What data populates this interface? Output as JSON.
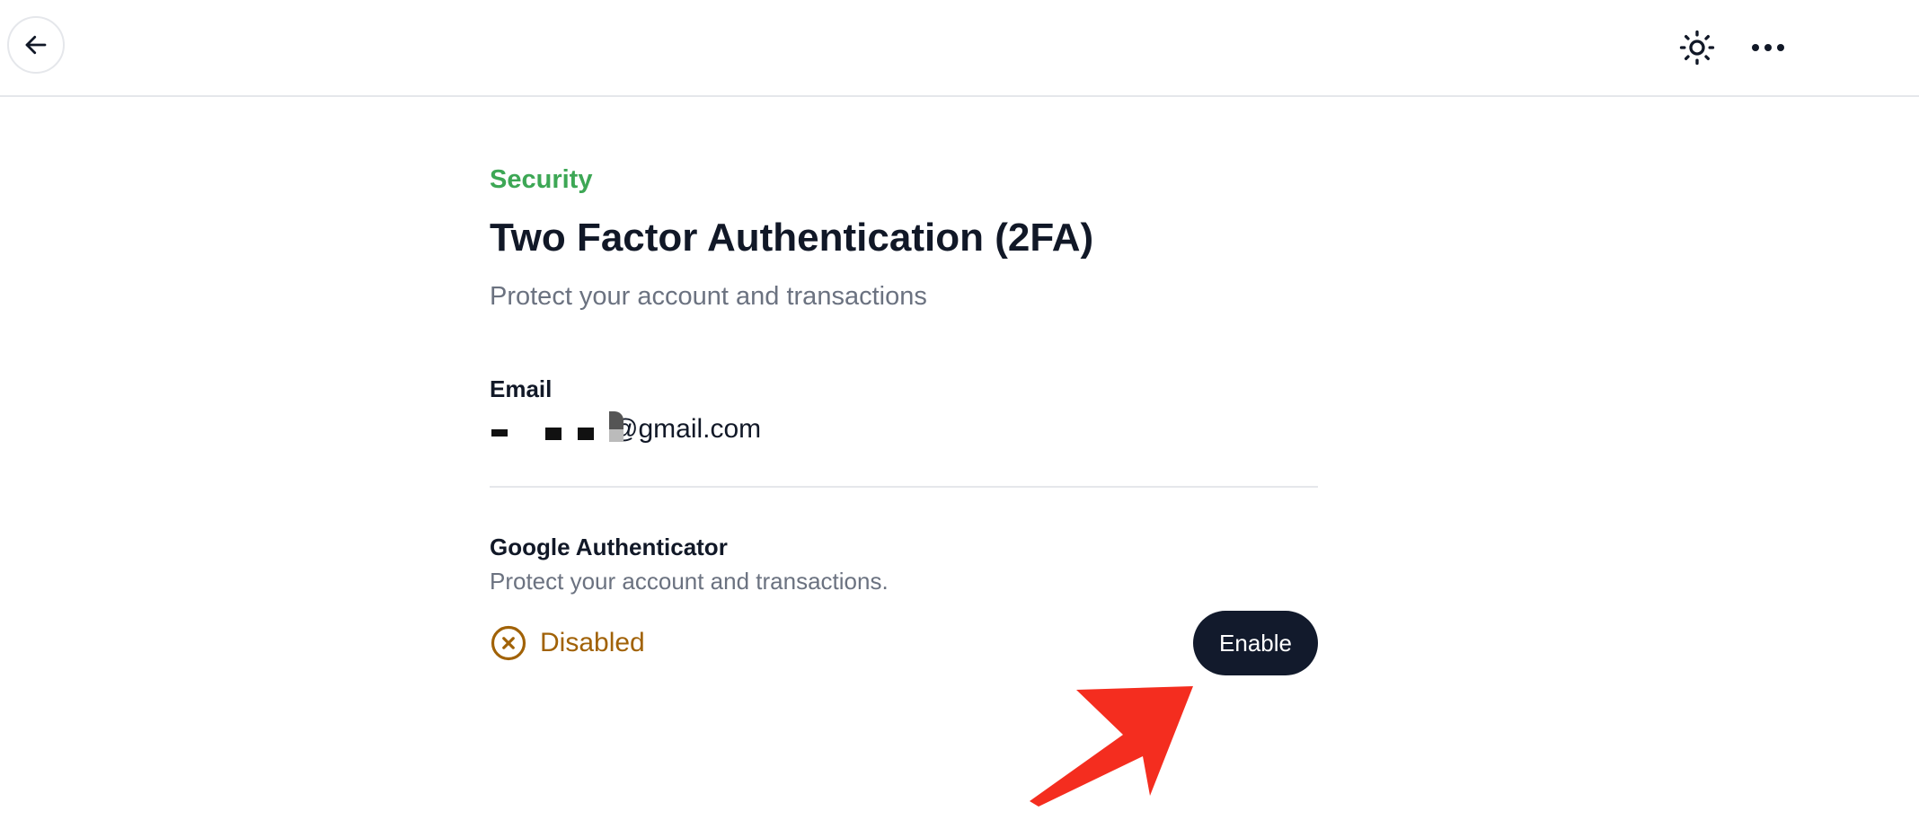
{
  "header": {
    "back_icon": "arrow-left-icon",
    "theme_icon": "sun-icon",
    "more_icon": "more-horizontal-icon"
  },
  "main": {
    "section_label": "Security",
    "title": "Two Factor Authentication (2FA)",
    "subtitle": "Protect your account and transactions",
    "email": {
      "label": "Email",
      "value_visible": "@gmail.com"
    },
    "authenticator": {
      "title": "Google Authenticator",
      "description": "Protect your account and transactions.",
      "status_icon": "x-circle-icon",
      "status_text": "Disabled",
      "action_label": "Enable"
    }
  },
  "colors": {
    "accent_green": "#3da755",
    "warning": "#a16207",
    "button_bg": "#121a2c",
    "annotation_arrow": "#f42d1f"
  }
}
